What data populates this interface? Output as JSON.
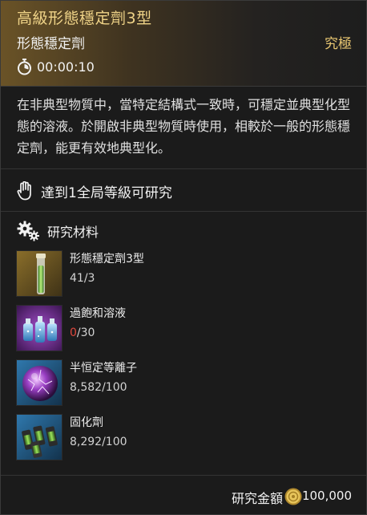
{
  "header": {
    "title": "高級形態穩定劑3型",
    "subtitle": "形態穩定劑",
    "rank": "究極",
    "timer": "00:00:10"
  },
  "description": "在非典型物質中，當特定結構式一致時，可穩定並典型化型態的溶液。於開啟非典型物質時使用，相較於一般的形態穩定劑，能更有效地典型化。",
  "requirement": {
    "text": "達到1全局等級可研究",
    "icon": "hand-icon"
  },
  "materials": {
    "heading": "研究材料",
    "heading_icon": "gears-icon",
    "items": [
      {
        "name": "形態穩定劑3型",
        "have": "41",
        "need": "/3",
        "have_short": false,
        "icon": "stabilizer-vial-icon",
        "rarity_color": "#b99a3c"
      },
      {
        "name": "過飽和溶液",
        "have": "0",
        "need": "/30",
        "have_short": true,
        "icon": "solution-bottles-icon",
        "rarity_color": "#7b2f9b"
      },
      {
        "name": "半恒定等離子",
        "have": "8,582",
        "need": "/100",
        "have_short": false,
        "icon": "plasma-orb-icon",
        "rarity_color": "#2b6a9a"
      },
      {
        "name": "固化劑",
        "have": "8,292",
        "need": "/100",
        "have_short": false,
        "icon": "hardener-cells-icon",
        "rarity_color": "#2b6a9a"
      }
    ]
  },
  "footer": {
    "cost_label": "研究金額",
    "cost_value": "100,000",
    "currency_icon": "coin-icon"
  },
  "colors": {
    "title_gold": "#f0d488",
    "rank_gold": "#e9c772",
    "short_red": "#e0483e"
  }
}
